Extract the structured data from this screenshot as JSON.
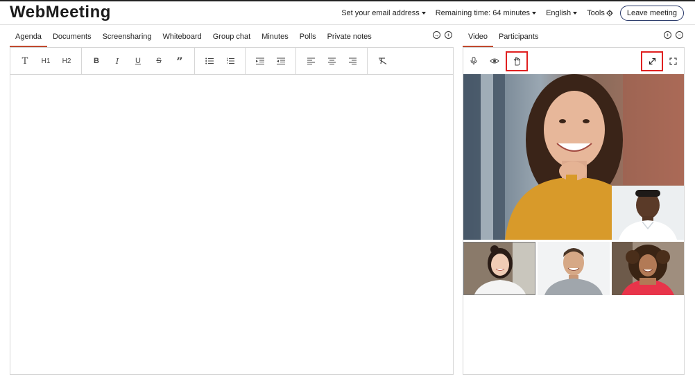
{
  "app": {
    "logo": "WebMeeting"
  },
  "nav": {
    "email": "Set your email address",
    "remaining": "Remaining time: 64 minutes",
    "language": "English",
    "tools": "Tools",
    "leave": "Leave meeting"
  },
  "left_tabs": [
    "Agenda",
    "Documents",
    "Screensharing",
    "Whiteboard",
    "Group chat",
    "Minutes",
    "Polls",
    "Private notes"
  ],
  "right_tabs": [
    "Video",
    "Participants"
  ],
  "editor": {
    "h1": "H1",
    "h2": "H2"
  },
  "colors": {
    "accent": "#c0492e",
    "highlight_box": "#e02020"
  }
}
